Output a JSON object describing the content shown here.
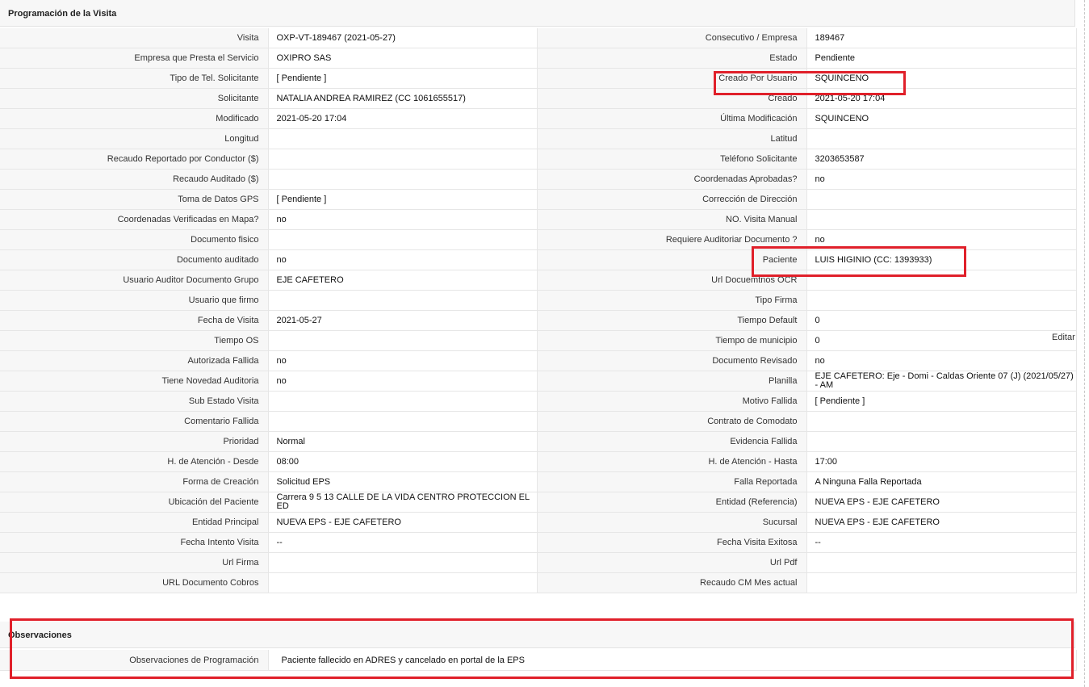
{
  "section_title": "Programación de la Visita",
  "edit_link": "Editar",
  "rows": [
    {
      "l1": "Visita",
      "v1": "OXP-VT-189467 (2021-05-27)",
      "l2": "Consecutivo / Empresa",
      "v2": "189467"
    },
    {
      "l1": "Empresa que Presta el Servicio",
      "v1": "OXIPRO SAS",
      "l2": "Estado",
      "v2": "Pendiente"
    },
    {
      "l1": "Tipo de Tel. Solicitante",
      "v1": "[ Pendiente ]",
      "l2": "Creado Por Usuario",
      "v2": "SQUINCENO"
    },
    {
      "l1": "Solicitante",
      "v1": "NATALIA ANDREA RAMIREZ (CC 1061655517)",
      "l2": "Creado",
      "v2": "2021-05-20 17:04"
    },
    {
      "l1": "Modificado",
      "v1": "2021-05-20 17:04",
      "l2": "Última Modificación",
      "v2": " SQUINCENO"
    },
    {
      "l1": "Longitud",
      "v1": "",
      "l2": "Latitud",
      "v2": ""
    },
    {
      "l1": "Recaudo Reportado por Conductor ($)",
      "v1": "",
      "l2": "Teléfono Solicitante",
      "v2": "3203653587"
    },
    {
      "l1": "Recaudo Auditado ($)",
      "v1": "",
      "l2": "Coordenadas Aprobadas?",
      "v2": " no"
    },
    {
      "l1": "Toma de Datos GPS",
      "v1": "[ Pendiente ]",
      "l2": "Corrección de Dirección",
      "v2": ""
    },
    {
      "l1": "Coordenadas Verificadas en Mapa?",
      "v1": " no",
      "l2": "NO. Visita Manual",
      "v2": ""
    },
    {
      "l1": "Documento fisico",
      "v1": "",
      "l2": "Requiere Auditoriar Documento ?",
      "v2": " no"
    },
    {
      "l1": "Documento auditado",
      "v1": " no",
      "l2": "Paciente",
      "v2": "LUIS HIGINIO (CC: 1393933)"
    },
    {
      "l1": "Usuario Auditor Documento Grupo",
      "v1": "EJE CAFETERO",
      "l2": "Url Docuemtnos OCR",
      "v2": ""
    },
    {
      "l1": "Usuario que firmo",
      "v1": "",
      "l2": "Tipo Firma",
      "v2": ""
    },
    {
      "l1": "Fecha de Visita",
      "v1": " 2021-05-27",
      "l2": "Tiempo Default",
      "v2": "0"
    },
    {
      "l1": "Tiempo OS",
      "v1": "",
      "l2": "Tiempo de municipio",
      "v2": "0"
    },
    {
      "l1": "Autorizada Fallida",
      "v1": " no",
      "l2": "Documento Revisado",
      "v2": " no"
    },
    {
      "l1": "Tiene Novedad Auditoria",
      "v1": " no",
      "l2": "Planilla",
      "v2": "EJE CAFETERO: Eje - Domi - Caldas Oriente 07 (J) (2021/05/27) - AM"
    },
    {
      "l1": "Sub Estado Visita",
      "v1": "",
      "l2": "Motivo Fallida",
      "v2": "[ Pendiente ]"
    },
    {
      "l1": "Comentario Fallida",
      "v1": "",
      "l2": "Contrato de Comodato",
      "v2": ""
    },
    {
      "l1": "Prioridad",
      "v1": "Normal",
      "l2": "Evidencia Fallida",
      "v2": ""
    },
    {
      "l1": "H. de Atención - Desde",
      "v1": "08:00",
      "l2": "H. de Atención - Hasta",
      "v2": "17:00"
    },
    {
      "l1": "Forma de Creación",
      "v1": "Solicitud EPS",
      "l2": "Falla Reportada",
      "v2": "A Ninguna Falla Reportada"
    },
    {
      "l1": "Ubicación del Paciente",
      "v1": "Carrera 9 5 13 CALLE DE LA VIDA CENTRO PROTECCION EL ED",
      "l2": "Entidad (Referencia)",
      "v2": "NUEVA EPS - EJE CAFETERO"
    },
    {
      "l1": "Entidad Principal",
      "v1": "NUEVA EPS - EJE CAFETERO",
      "l2": "Sucursal",
      "v2": "NUEVA EPS - EJE CAFETERO"
    },
    {
      "l1": "Fecha Intento Visita",
      "v1": " --",
      "l2": "Fecha Visita Exitosa",
      "v2": " --"
    },
    {
      "l1": "Url Firma",
      "v1": "",
      "l2": "Url Pdf",
      "v2": ""
    },
    {
      "l1": "URL Documento Cobros",
      "v1": "",
      "l2": "Recaudo CM Mes actual",
      "v2": ""
    }
  ],
  "observaciones": {
    "title": "Observaciones",
    "label": "Observaciones de Programación",
    "value": "Paciente fallecido en ADRES y cancelado en portal de la EPS"
  },
  "colors": {
    "highlight": "#e0202a",
    "label_bg": "#f7f7f7",
    "border": "#e6e6e6"
  }
}
